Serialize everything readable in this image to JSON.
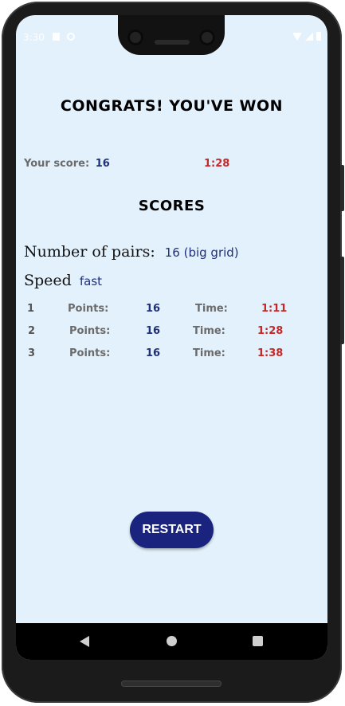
{
  "status": {
    "time": "3:30"
  },
  "game": {
    "title": "CONGRATS! YOU'VE WON",
    "your_score_label": "Your score:",
    "your_score_value": "16",
    "your_time": "1:28"
  },
  "scores": {
    "heading": "SCORES",
    "pairs_label": "Number of pairs:",
    "pairs_value": "16 (big grid)",
    "speed_label": "Speed",
    "speed_value": "fast",
    "rows": [
      {
        "rank": "1",
        "points_label": "Points:",
        "points": "16",
        "time_label": "Time:",
        "time": "1:11"
      },
      {
        "rank": "2",
        "points_label": "Points:",
        "points": "16",
        "time_label": "Time:",
        "time": "1:28"
      },
      {
        "rank": "3",
        "points_label": "Points:",
        "points": "16",
        "time_label": "Time:",
        "time": "1:38"
      }
    ]
  },
  "actions": {
    "restart_label": "RESTART"
  },
  "colors": {
    "background": "#e3f1fc",
    "accent_blue": "#1a237e",
    "value_blue": "#1f2f7a",
    "time_red": "#c62828"
  },
  "icons": [
    "sd-card-icon",
    "block-icon",
    "wifi-icon",
    "signal-icon",
    "battery-icon",
    "back-icon",
    "home-icon",
    "recents-icon"
  ]
}
